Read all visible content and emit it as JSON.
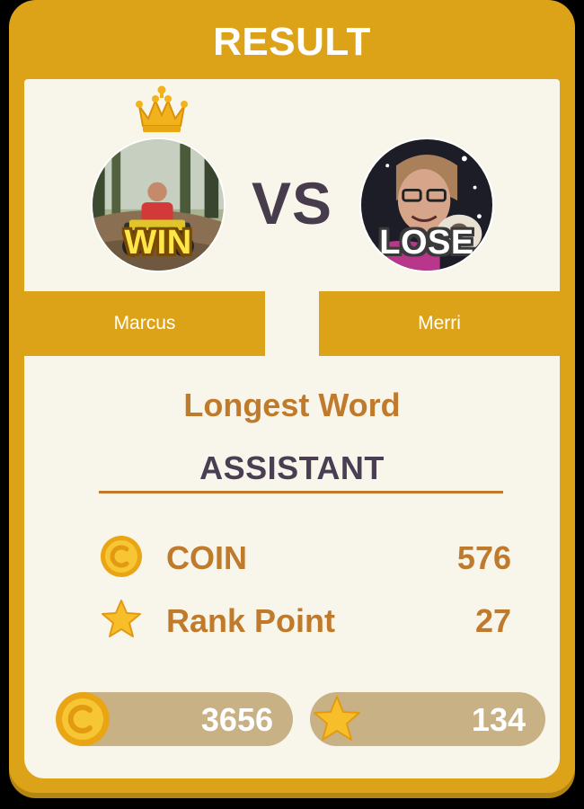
{
  "title": "RESULT",
  "players": {
    "winner": {
      "name": "Marcus",
      "badge": "WIN"
    },
    "loser": {
      "name": "Merri",
      "badge": "LOSE"
    },
    "versus": "VS"
  },
  "longest_word": {
    "label": "Longest Word",
    "word": "ASSISTANT"
  },
  "rewards": {
    "coin": {
      "icon": "coin-icon",
      "label": "COIN",
      "value": "576"
    },
    "rank": {
      "icon": "star-icon",
      "label": "Rank Point",
      "value": "27"
    }
  },
  "totals": {
    "coins": {
      "icon": "coin-icon",
      "value": "3656"
    },
    "stars": {
      "icon": "star-icon",
      "value": "134"
    }
  },
  "colors": {
    "frame": "#dda318",
    "panel": "#f8f5ea",
    "accent_text": "#c07a2c",
    "dark_text": "#4a3e52",
    "pill": "#c9b186"
  }
}
